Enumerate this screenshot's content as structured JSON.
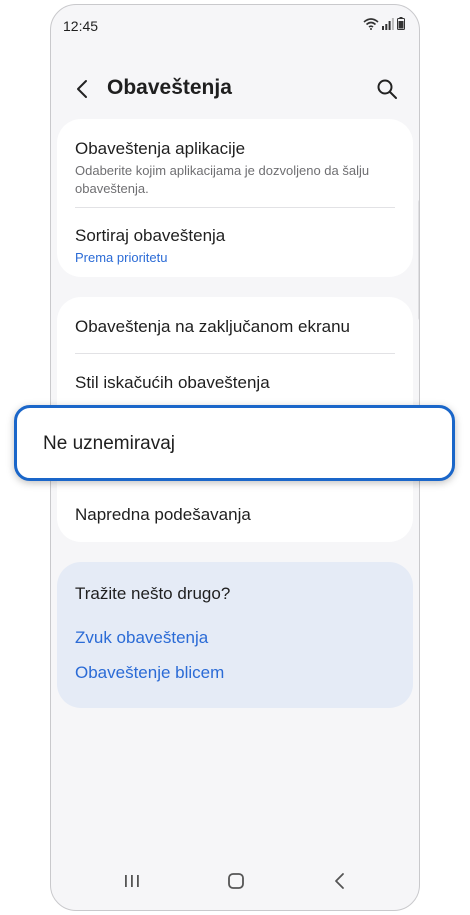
{
  "status": {
    "time": "12:45"
  },
  "header": {
    "title": "Obaveštenja"
  },
  "section1": {
    "app_notifications": {
      "title": "Obaveštenja aplikacije",
      "subtitle": "Odaberite kojim aplikacijama je dozvoljeno da šalju obaveštenja."
    },
    "sort_notifications": {
      "title": "Sortiraj obaveštenja",
      "subtitle": "Prema prioritetu"
    }
  },
  "section2": {
    "lock_screen": "Obaveštenja na zaključanom ekranu",
    "popup_style": "Stil iskačućih obaveštenja",
    "do_not_disturb": "Ne uznemiravaj",
    "advanced": "Napredna podešavanja"
  },
  "suggestions": {
    "title": "Tražite nešto drugo?",
    "links": [
      "Zvuk obaveštenja",
      "Obaveštenje blicem"
    ]
  },
  "colors": {
    "accent": "#2b6bd6",
    "highlight_border": "#1a66c9",
    "suggestion_bg": "#e5ebf6"
  },
  "icons": [
    "back-arrow-icon",
    "search-icon",
    "wifi-icon",
    "signal-icon",
    "battery-icon",
    "recent-apps-icon",
    "home-icon",
    "back-icon"
  ]
}
